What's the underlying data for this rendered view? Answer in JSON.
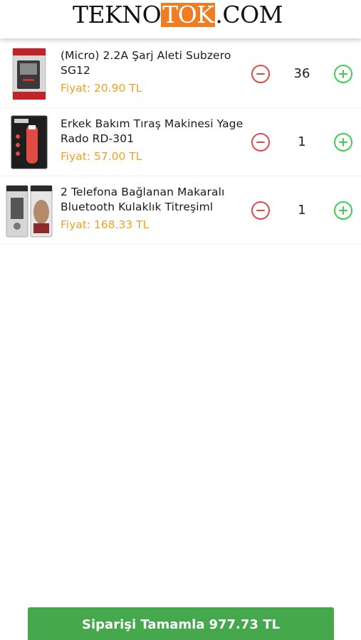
{
  "header": {
    "logo_part1": "TEKNO",
    "logo_part2": "TOK",
    "logo_part3": ".COM",
    "accent": "#ef7d22"
  },
  "cart": {
    "items": [
      {
        "name": "(Micro) 2.2A Şarj Aleti Subzero SG12",
        "price": "Fiyat: 20.90 TL",
        "quantity": "36",
        "image_icon": "charger-product-image"
      },
      {
        "name": "Erkek Bakım Tıraş Makinesi Yage Rado RD-301",
        "price": "Fiyat: 57.00 TL",
        "quantity": "1",
        "image_icon": "trimmer-product-image"
      },
      {
        "name": "2 Telefona Bağlanan Makaralı Bluetooth Kulaklık Titreşiml",
        "price": "Fiyat: 168.33 TL",
        "quantity": "1",
        "image_icon": "headset-product-image"
      }
    ]
  },
  "checkout": {
    "label": "Siparişi Tamamla",
    "total": "977.73 TL"
  },
  "colors": {
    "price": "#f0a020",
    "minus": "#e04a4a",
    "plus": "#3fcf4f",
    "checkout": "#45a84c"
  }
}
